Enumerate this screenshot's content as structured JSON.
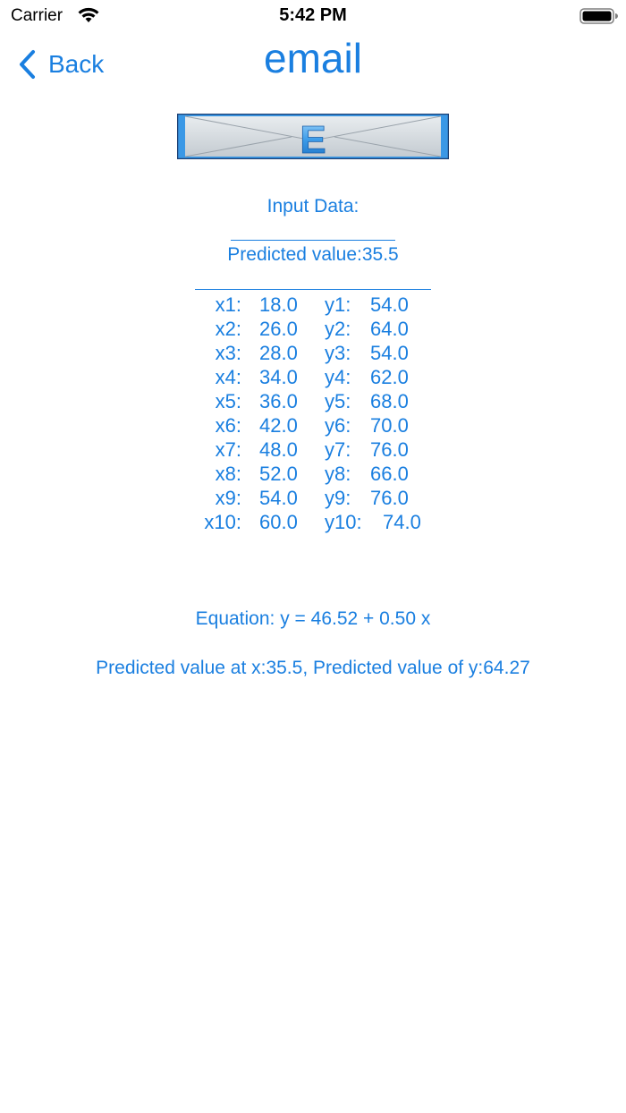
{
  "status_bar": {
    "carrier": "Carrier",
    "time": "5:42 PM"
  },
  "nav": {
    "back_label": "Back",
    "title": "email"
  },
  "banner": {
    "letter": "E"
  },
  "content": {
    "input_data_label": "Input Data:",
    "predicted_value_label": "Predicted value:35.5",
    "rows": [
      {
        "x_label": "x1:",
        "x_value": "18.0",
        "y_label": "y1:",
        "y_value": "54.0"
      },
      {
        "x_label": "x2:",
        "x_value": "26.0",
        "y_label": "y2:",
        "y_value": "64.0"
      },
      {
        "x_label": "x3:",
        "x_value": "28.0",
        "y_label": "y3:",
        "y_value": "54.0"
      },
      {
        "x_label": "x4:",
        "x_value": "34.0",
        "y_label": "y4:",
        "y_value": "62.0"
      },
      {
        "x_label": "x5:",
        "x_value": "36.0",
        "y_label": "y5:",
        "y_value": "68.0"
      },
      {
        "x_label": "x6:",
        "x_value": "42.0",
        "y_label": "y6:",
        "y_value": "70.0"
      },
      {
        "x_label": "x7:",
        "x_value": "48.0",
        "y_label": "y7:",
        "y_value": "76.0"
      },
      {
        "x_label": "x8:",
        "x_value": "52.0",
        "y_label": "y8:",
        "y_value": "66.0"
      },
      {
        "x_label": "x9:",
        "x_value": "54.0",
        "y_label": "y9:",
        "y_value": "76.0"
      },
      {
        "x_label": "x10:",
        "x_value": "60.0",
        "y_label": "y10:",
        "y_value": "74.0"
      }
    ],
    "equation": "Equation: y = 46.52 + 0.50 x",
    "prediction_result": "Predicted value at x:35.5, Predicted value of y:64.27"
  },
  "colors": {
    "accent": "#1a7fe0",
    "banner_border": "#1c3f73",
    "banner_fill": "#3a98e6"
  }
}
